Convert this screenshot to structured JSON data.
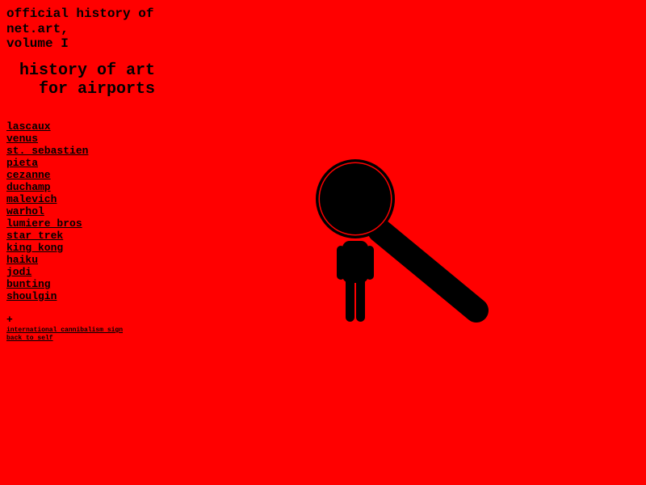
{
  "header": {
    "title_lines": [
      "official history of",
      "net.art,",
      "volume I"
    ]
  },
  "subtitle": {
    "lines": [
      "history of art",
      "for airports"
    ]
  },
  "nav": {
    "links": [
      "lascaux",
      "venus",
      "st. sebastien",
      "pieta",
      "cezanne",
      "duchamp",
      "malevich",
      "warhol",
      "lumiere bros",
      "star trek",
      "king kong",
      "haiku",
      "jodi",
      "bunting",
      "shoulgin"
    ]
  },
  "extra": {
    "plus": "+",
    "international_cannibalism_sign": "international cannibalism sign",
    "back_to_self": "back to self"
  },
  "illustration": {
    "icon": "magnifying-glass-person-icon"
  },
  "colors": {
    "background": "#ff0000",
    "foreground": "#000000"
  }
}
